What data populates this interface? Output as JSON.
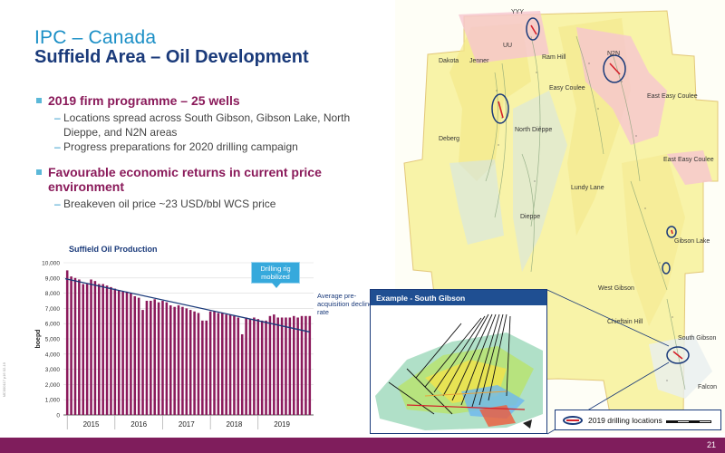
{
  "header": {
    "title": "IPC – Canada",
    "subtitle": "Suffield Area – Oil Development"
  },
  "bullets": [
    {
      "heading": "2019 firm programme – 25 wells",
      "subs": [
        "Locations spread across South Gibson, Gibson Lake, North Dieppe, and N2N areas",
        "Progress preparations for 2020 drilling campaign"
      ]
    },
    {
      "heading": "Favourable economic returns in current price environment",
      "subs": [
        "Breakeven oil price ~23 USD/bbl WCS price"
      ]
    }
  ],
  "chart_data": {
    "type": "bar",
    "title": "Suffield Oil Production",
    "ylabel": "boepd",
    "xlabel": "",
    "ylim": [
      0,
      10000
    ],
    "yticks": [
      "0",
      "1,000",
      "2,000",
      "3,000",
      "4,000",
      "5,000",
      "6,000",
      "7,000",
      "8,000",
      "9,000",
      "10,000"
    ],
    "xticks": [
      "2015",
      "2016",
      "2017",
      "2018",
      "2019"
    ],
    "bar_color": "#8b1a5c",
    "trend_color": "#1a3a7a",
    "values": [
      9500,
      9100,
      9000,
      8900,
      8600,
      8600,
      8900,
      8800,
      8600,
      8600,
      8500,
      8400,
      8300,
      8200,
      8100,
      8100,
      8000,
      7800,
      7700,
      6900,
      7500,
      7500,
      7600,
      7400,
      7500,
      7400,
      7200,
      7100,
      7200,
      7100,
      7000,
      6900,
      6800,
      6700,
      6200,
      6200,
      6800,
      6800,
      6700,
      6700,
      6600,
      6600,
      6500,
      6400,
      5300,
      6400,
      6300,
      6400,
      6300,
      6200,
      6200,
      6500,
      6600,
      6400,
      6400,
      6400,
      6400,
      6500,
      6400,
      6500,
      6500,
      6500
    ],
    "trend": {
      "start": 8950,
      "end": 5450
    },
    "annotations": [
      "Drilling rig mobilized",
      "Average pre-acquisition decline rate"
    ]
  },
  "map": {
    "labels": [
      "YYY",
      "UU",
      "Ram Hill",
      "Dakota",
      "Jenner",
      "N2N",
      "Easy Coulee",
      "East Easy Coulee",
      "North Dieppe",
      "Deberg",
      "East Easy Coulee",
      "Lundy Lane",
      "Dieppe",
      "Gibson Lake",
      "West Gibson",
      "Chieftain Hill",
      "South Gibson",
      "Falcon"
    ],
    "inset_title": "Example - South Gibson",
    "legend_label": "2019 drilling locations"
  },
  "footer": {
    "page": "21",
    "side_code": "MC000117 p16 02-19"
  }
}
